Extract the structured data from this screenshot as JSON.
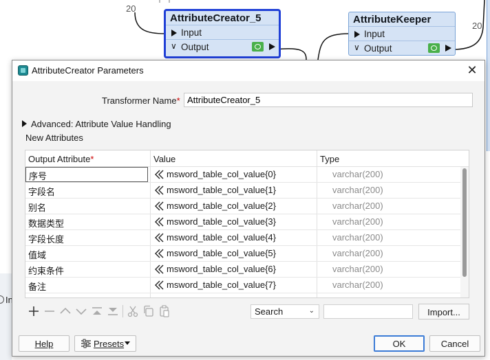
{
  "canvas": {
    "counts": [
      "20",
      "20"
    ],
    "nodes": [
      {
        "title": "AttributeCreator_5",
        "input": "Input",
        "output": "Output"
      },
      {
        "title": "AttributeKeeper",
        "input": "Input",
        "output": "Output"
      }
    ],
    "side_fragment": "In"
  },
  "dialog": {
    "title": "AttributeCreator Parameters",
    "transformer_name_label": "Transformer Name",
    "required_mark": "*",
    "transformer_name_value": "AttributeCreator_5",
    "advanced_label": "Advanced: Attribute Value Handling",
    "new_attributes_label": "New Attributes",
    "table": {
      "headers": [
        "Output Attribute",
        "Value",
        "Type"
      ],
      "rows": [
        {
          "attr": "序号",
          "value": "msword_table_col_value{0}",
          "type": "varchar(200)"
        },
        {
          "attr": "字段名",
          "value": "msword_table_col_value{1}",
          "type": "varchar(200)"
        },
        {
          "attr": "别名",
          "value": "msword_table_col_value{2}",
          "type": "varchar(200)"
        },
        {
          "attr": "数据类型",
          "value": "msword_table_col_value{3}",
          "type": "varchar(200)"
        },
        {
          "attr": "字段长度",
          "value": "msword_table_col_value{4}",
          "type": "varchar(200)"
        },
        {
          "attr": "值域",
          "value": "msword_table_col_value{5}",
          "type": "varchar(200)"
        },
        {
          "attr": "约束条件",
          "value": "msword_table_col_value{6}",
          "type": "varchar(200)"
        },
        {
          "attr": "备注",
          "value": "msword_table_col_value{7}",
          "type": "varchar(200)"
        }
      ]
    },
    "toolbar": {
      "icons": [
        "add-icon",
        "remove-icon",
        "move-up-icon",
        "move-down-icon",
        "move-top-icon",
        "move-bottom-icon",
        "cut-icon",
        "copy-icon",
        "paste-icon"
      ],
      "search_selected": "Search",
      "search_placeholder": "",
      "import_label": "Import..."
    },
    "buttons": {
      "help": "Help",
      "presets": "Presets",
      "ok": "OK",
      "cancel": "Cancel"
    }
  },
  "colors": {
    "selected_node_border": "#1f3fd6",
    "node_fill": "#d5e3f5",
    "visualizer_green": "#49b04a",
    "required_red": "#cc0000",
    "ok_border": "#3b7bd6"
  }
}
